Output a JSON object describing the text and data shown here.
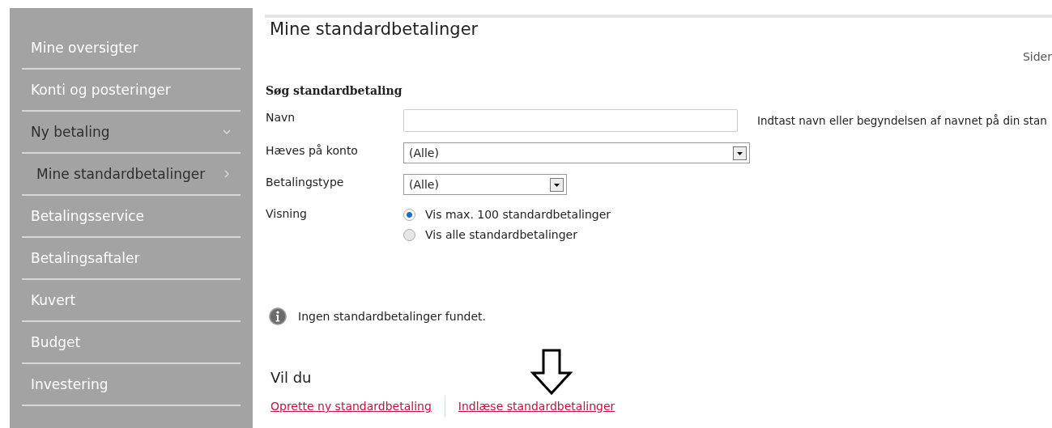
{
  "sidebar": {
    "items": [
      {
        "label": "Mine oversigter",
        "selected": false
      },
      {
        "label": "Konti og posteringer",
        "selected": false
      },
      {
        "label": "Ny betaling",
        "expanded": true,
        "children": [
          {
            "label": "Mine standardbetalinger",
            "selected": true
          }
        ]
      },
      {
        "label": "Betalingsservice",
        "selected": false
      },
      {
        "label": "Betalingsaftaler",
        "selected": false
      },
      {
        "label": "Kuvert",
        "selected": false
      },
      {
        "label": "Budget",
        "selected": false
      },
      {
        "label": "Investering",
        "selected": false
      }
    ]
  },
  "page": {
    "title": "Mine standardbetalinger",
    "sider": "Sider"
  },
  "search": {
    "heading": "Søg standardbetaling",
    "name_label": "Navn",
    "name_hint": "Indtast navn eller begyndelsen af navnet på din stan",
    "account_label": "Hæves på konto",
    "account_value": "(Alle)",
    "type_label": "Betalingstype",
    "type_value": "(Alle)",
    "view_label": "Visning",
    "view_options": [
      {
        "label": "Vis max. 100 standardbetalinger",
        "selected": true
      },
      {
        "label": "Vis alle standardbetalinger",
        "selected": false
      }
    ]
  },
  "message": "Ingen standardbetalinger fundet.",
  "actions": {
    "heading": "Vil du",
    "links": [
      "Oprette ny standardbetaling",
      "Indlæse standardbetalinger"
    ]
  }
}
